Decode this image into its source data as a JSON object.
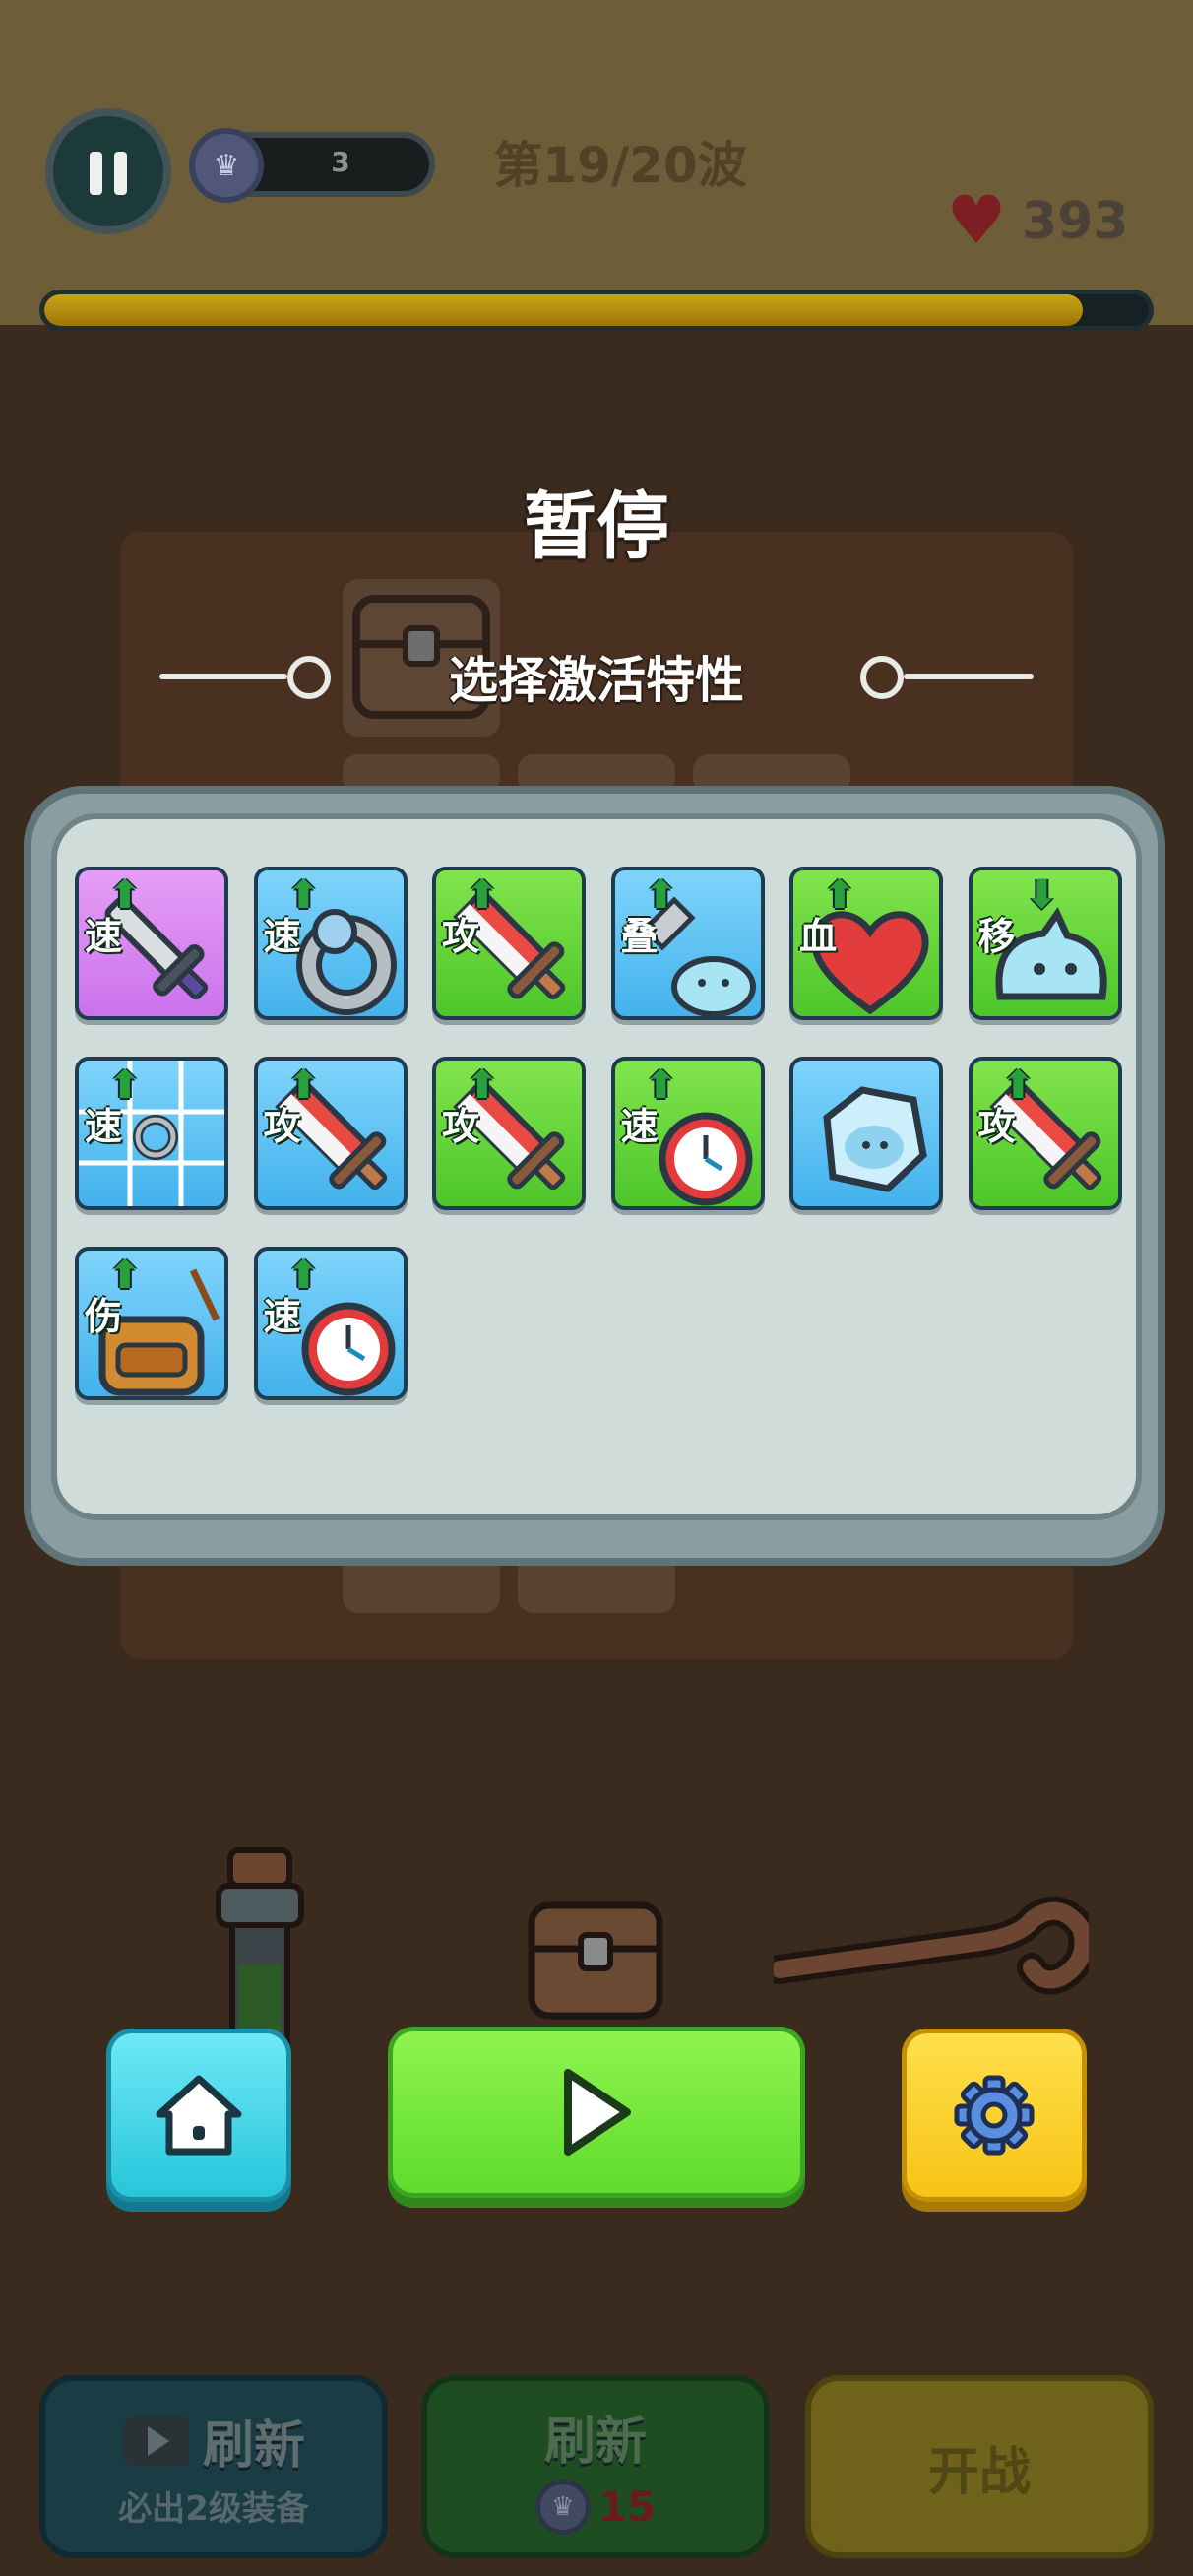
{
  "hud": {
    "xp_level": "3",
    "wave_text": "第19/20波",
    "hp_value": "393",
    "wave_progress": 0.94
  },
  "pause_overlay": {
    "title": "暂停",
    "subtitle": "选择激活特性"
  },
  "traits": [
    {
      "label": "速",
      "theme": "purple",
      "art": "sword-icon",
      "arrow": "up"
    },
    {
      "label": "速",
      "theme": "blue",
      "art": "ring-icon",
      "arrow": "up"
    },
    {
      "label": "攻",
      "theme": "green",
      "art": "red-sword-icon",
      "arrow": "up"
    },
    {
      "label": "叠",
      "theme": "blue",
      "art": "axe-slime-icon",
      "arrow": "up"
    },
    {
      "label": "血",
      "theme": "green",
      "art": "heart-icon",
      "arrow": "up"
    },
    {
      "label": "移",
      "theme": "green",
      "art": "slime-icon",
      "arrow": "down"
    },
    {
      "label": "速",
      "theme": "blue",
      "art": "grid-ring-icon",
      "arrow": "up"
    },
    {
      "label": "攻",
      "theme": "blue",
      "art": "red-sword-icon",
      "arrow": "up"
    },
    {
      "label": "攻",
      "theme": "green",
      "art": "red-sword-icon",
      "arrow": "up"
    },
    {
      "label": "速",
      "theme": "green",
      "art": "clock-icon",
      "arrow": "up"
    },
    {
      "label": "",
      "theme": "blue",
      "art": "ice-slime-icon",
      "arrow": "none"
    },
    {
      "label": "攻",
      "theme": "green",
      "art": "red-sword-icon",
      "arrow": "up"
    },
    {
      "label": "伤",
      "theme": "blue",
      "art": "backpack-icon",
      "arrow": "up"
    },
    {
      "label": "速",
      "theme": "blue",
      "art": "clock-icon",
      "arrow": "up"
    }
  ],
  "controls": {
    "home_icon": "home-icon",
    "play_icon": "play-icon",
    "settings_icon": "gear-icon"
  },
  "bottom_bar": {
    "ad_refresh_label": "刷新",
    "ad_refresh_sub": "必出2级装备",
    "refresh_label": "刷新",
    "refresh_cost": "15",
    "battle_label": "开战"
  },
  "colors": {
    "purple": "#d47ff0",
    "blue": "#5cc2f2",
    "green": "#62d13a",
    "play_green": "#74e53a",
    "home_cyan": "#46d6e8",
    "settings_yellow": "#fbd12e"
  }
}
